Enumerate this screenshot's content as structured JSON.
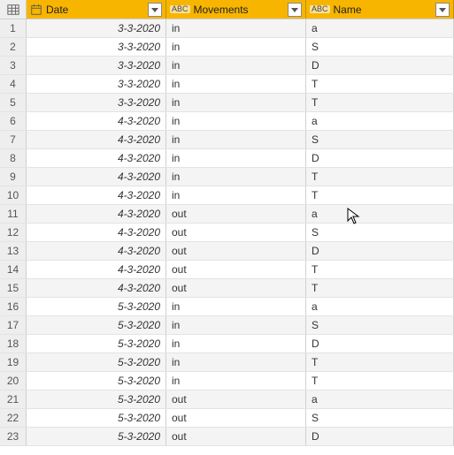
{
  "columns": {
    "date": {
      "label": "Date",
      "icon": "date-icon",
      "type_icon": null
    },
    "movements": {
      "label": "Movements",
      "icon": null,
      "type_icon": "ABC"
    },
    "name": {
      "label": "Name",
      "icon": null,
      "type_icon": "ABC"
    }
  },
  "rows": [
    {
      "n": 1,
      "date": "3-3-2020",
      "movements": "in",
      "name": "a"
    },
    {
      "n": 2,
      "date": "3-3-2020",
      "movements": "in",
      "name": "S"
    },
    {
      "n": 3,
      "date": "3-3-2020",
      "movements": "in",
      "name": "D"
    },
    {
      "n": 4,
      "date": "3-3-2020",
      "movements": "in",
      "name": "T"
    },
    {
      "n": 5,
      "date": "3-3-2020",
      "movements": "in",
      "name": "T"
    },
    {
      "n": 6,
      "date": "4-3-2020",
      "movements": "in",
      "name": "a"
    },
    {
      "n": 7,
      "date": "4-3-2020",
      "movements": "in",
      "name": "S"
    },
    {
      "n": 8,
      "date": "4-3-2020",
      "movements": "in",
      "name": "D"
    },
    {
      "n": 9,
      "date": "4-3-2020",
      "movements": "in",
      "name": "T"
    },
    {
      "n": 10,
      "date": "4-3-2020",
      "movements": "in",
      "name": "T"
    },
    {
      "n": 11,
      "date": "4-3-2020",
      "movements": "out",
      "name": "a"
    },
    {
      "n": 12,
      "date": "4-3-2020",
      "movements": "out",
      "name": "S"
    },
    {
      "n": 13,
      "date": "4-3-2020",
      "movements": "out",
      "name": "D"
    },
    {
      "n": 14,
      "date": "4-3-2020",
      "movements": "out",
      "name": "T"
    },
    {
      "n": 15,
      "date": "4-3-2020",
      "movements": "out",
      "name": "T"
    },
    {
      "n": 16,
      "date": "5-3-2020",
      "movements": "in",
      "name": "a"
    },
    {
      "n": 17,
      "date": "5-3-2020",
      "movements": "in",
      "name": "S"
    },
    {
      "n": 18,
      "date": "5-3-2020",
      "movements": "in",
      "name": "D"
    },
    {
      "n": 19,
      "date": "5-3-2020",
      "movements": "in",
      "name": "T"
    },
    {
      "n": 20,
      "date": "5-3-2020",
      "movements": "in",
      "name": "T"
    },
    {
      "n": 21,
      "date": "5-3-2020",
      "movements": "out",
      "name": "a"
    },
    {
      "n": 22,
      "date": "5-3-2020",
      "movements": "out",
      "name": "S"
    },
    {
      "n": 23,
      "date": "5-3-2020",
      "movements": "out",
      "name": "D"
    }
  ]
}
